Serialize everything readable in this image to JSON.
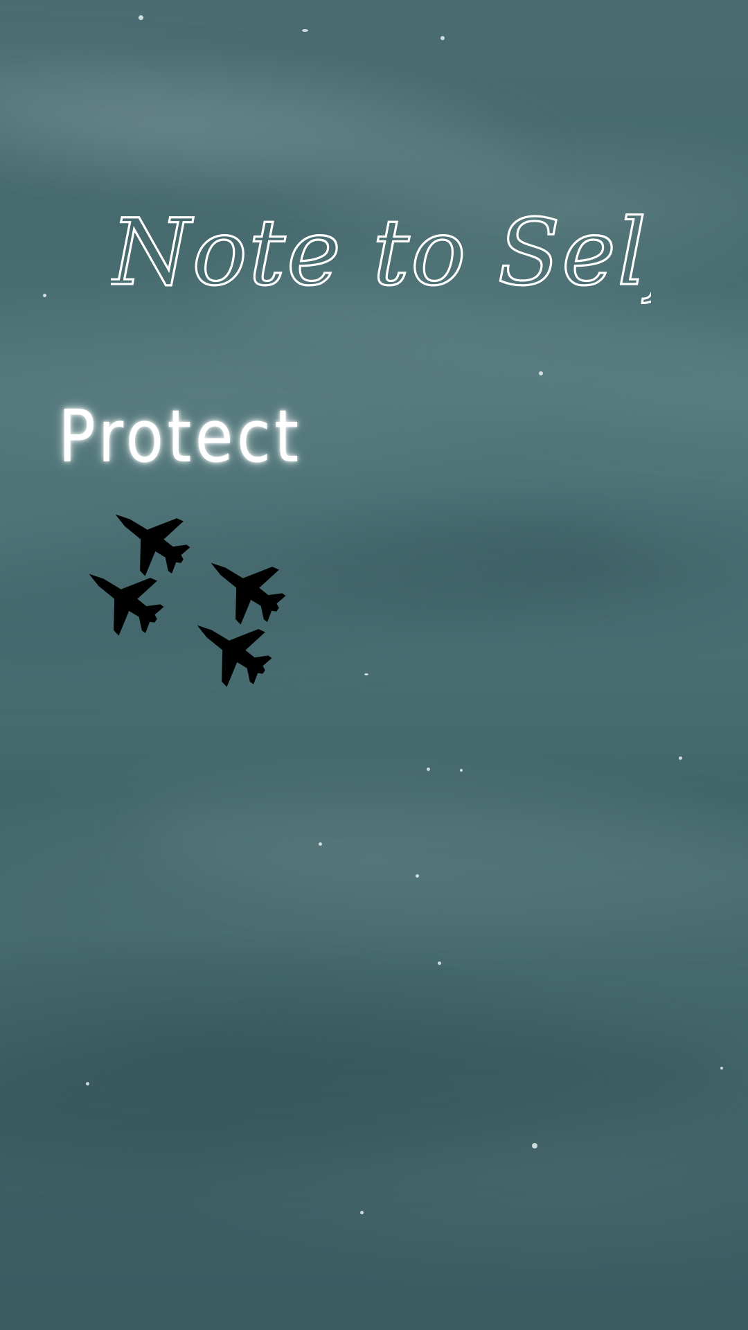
{
  "wallpaper": {
    "title": "Note to Self",
    "caption": "Protect",
    "colors": {
      "sky": "#466a6e",
      "text": "#ffffff",
      "jets": "#16242a"
    },
    "jet_count": 4
  }
}
